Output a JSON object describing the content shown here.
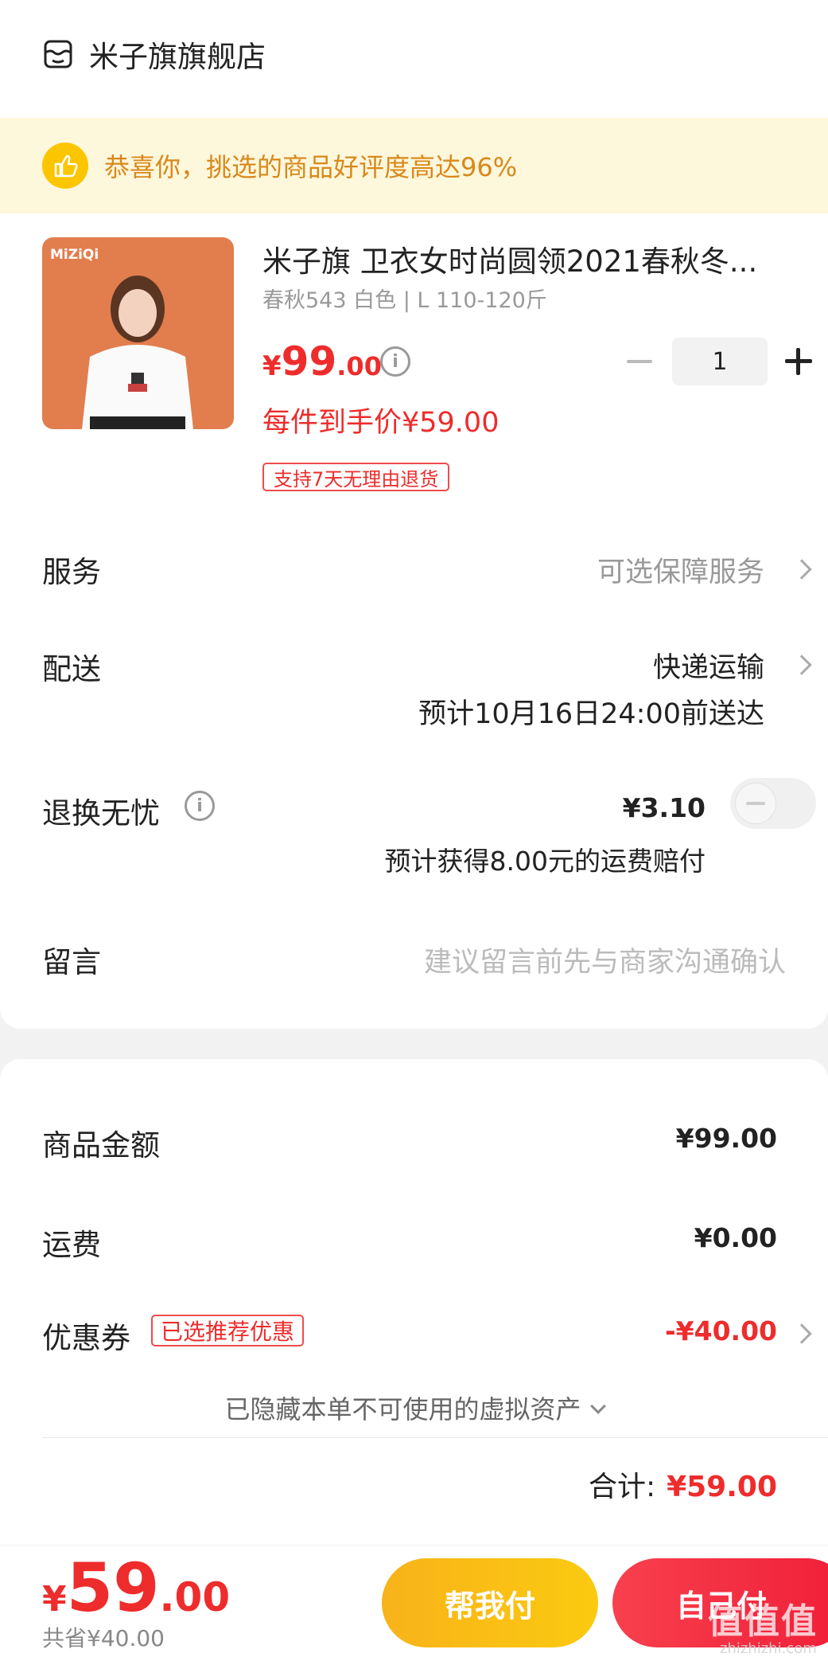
{
  "shop": {
    "name": "米子旗旗舰店"
  },
  "banner": {
    "text": "恭喜你，挑选的商品好评度高达96%"
  },
  "product": {
    "image_brand": "MiZiQi",
    "title": "米子旗 卫衣女时尚圆领2021春秋冬...",
    "spec": "春秋543 白色 | L 110-120斤",
    "price_symbol": "¥",
    "price_int": "99",
    "price_dec": ".00",
    "final_price": "每件到手价¥59.00",
    "return_tag": "支持7天无理由退货",
    "quantity": "1"
  },
  "rows": {
    "service": {
      "label": "服务",
      "value": "可选保障服务"
    },
    "delivery": {
      "label": "配送",
      "value": "快递运输",
      "eta": "预计10月16日24:00前送达"
    },
    "return_worry": {
      "label": "退换无忧",
      "price": "¥3.10",
      "note": "预计获得8.00元的运费赔付",
      "enabled": false
    },
    "message": {
      "label": "留言",
      "placeholder": "建议留言前先与商家沟通确认"
    }
  },
  "summary": {
    "goods_label": "商品金额",
    "goods_value": "¥99.00",
    "shipping_label": "运费",
    "shipping_value": "¥0.00",
    "coupon_label": "优惠券",
    "coupon_badge": "已选推荐优惠",
    "coupon_value": "-¥40.00",
    "hidden_assets": "已隐藏本单不可使用的虚拟资产",
    "total_label": "合计:",
    "total_value": "¥59.00"
  },
  "bottom": {
    "price_symbol": "¥",
    "price_int": "59",
    "price_dec": ".00",
    "saved": "共省¥40.00",
    "help_pay": "帮我付",
    "self_pay": "自己付"
  },
  "watermark": {
    "text": "值值值",
    "url": "zhizhizhi.com"
  },
  "colors": {
    "accent_red": "#ee2c2c",
    "banner_bg": "#fdf7dc",
    "banner_text": "#d9881a",
    "help_btn": "#fbc600",
    "pay_btn": "#f01e38"
  }
}
